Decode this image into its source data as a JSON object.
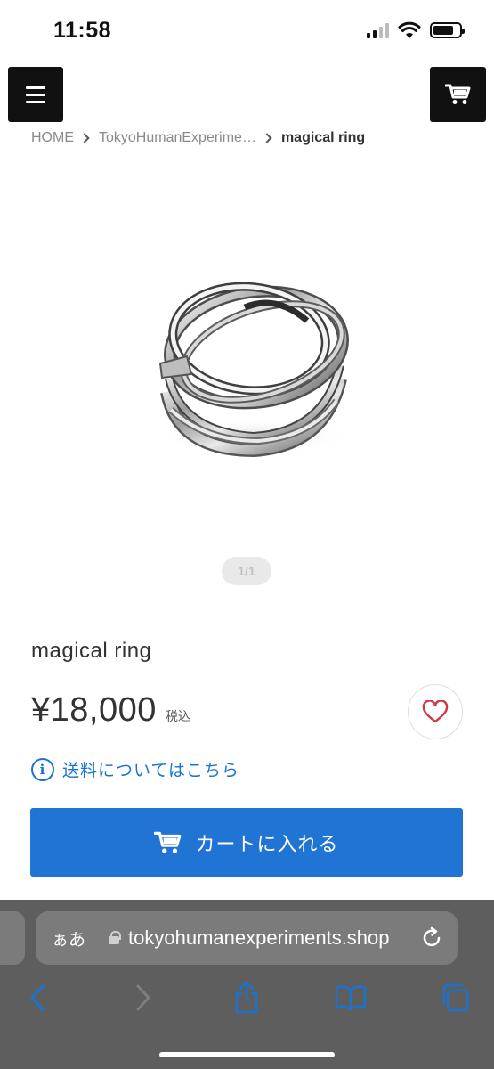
{
  "status_bar": {
    "time": "11:58"
  },
  "header": {
    "menu_icon": "hamburger-icon",
    "cart_icon": "cart-icon"
  },
  "breadcrumb": {
    "home": "HOME",
    "category": "TokyoHumanExperime…",
    "current": "magical ring"
  },
  "gallery": {
    "pager": "1/1"
  },
  "product": {
    "title": "magical ring",
    "price": "¥18,000",
    "tax_label": "税込",
    "shipping_link": "送料についてはこちら",
    "add_to_cart": "カートに入れる",
    "favorite_icon": "heart-icon"
  },
  "browser": {
    "text_size_label": "ぁあ",
    "url": "tokyohumanexperiments.shop",
    "accent_color": "#1a73d1"
  },
  "colors": {
    "primary_button": "#1f74d4",
    "link": "#1a73d1",
    "favorite": "#d0394a"
  }
}
